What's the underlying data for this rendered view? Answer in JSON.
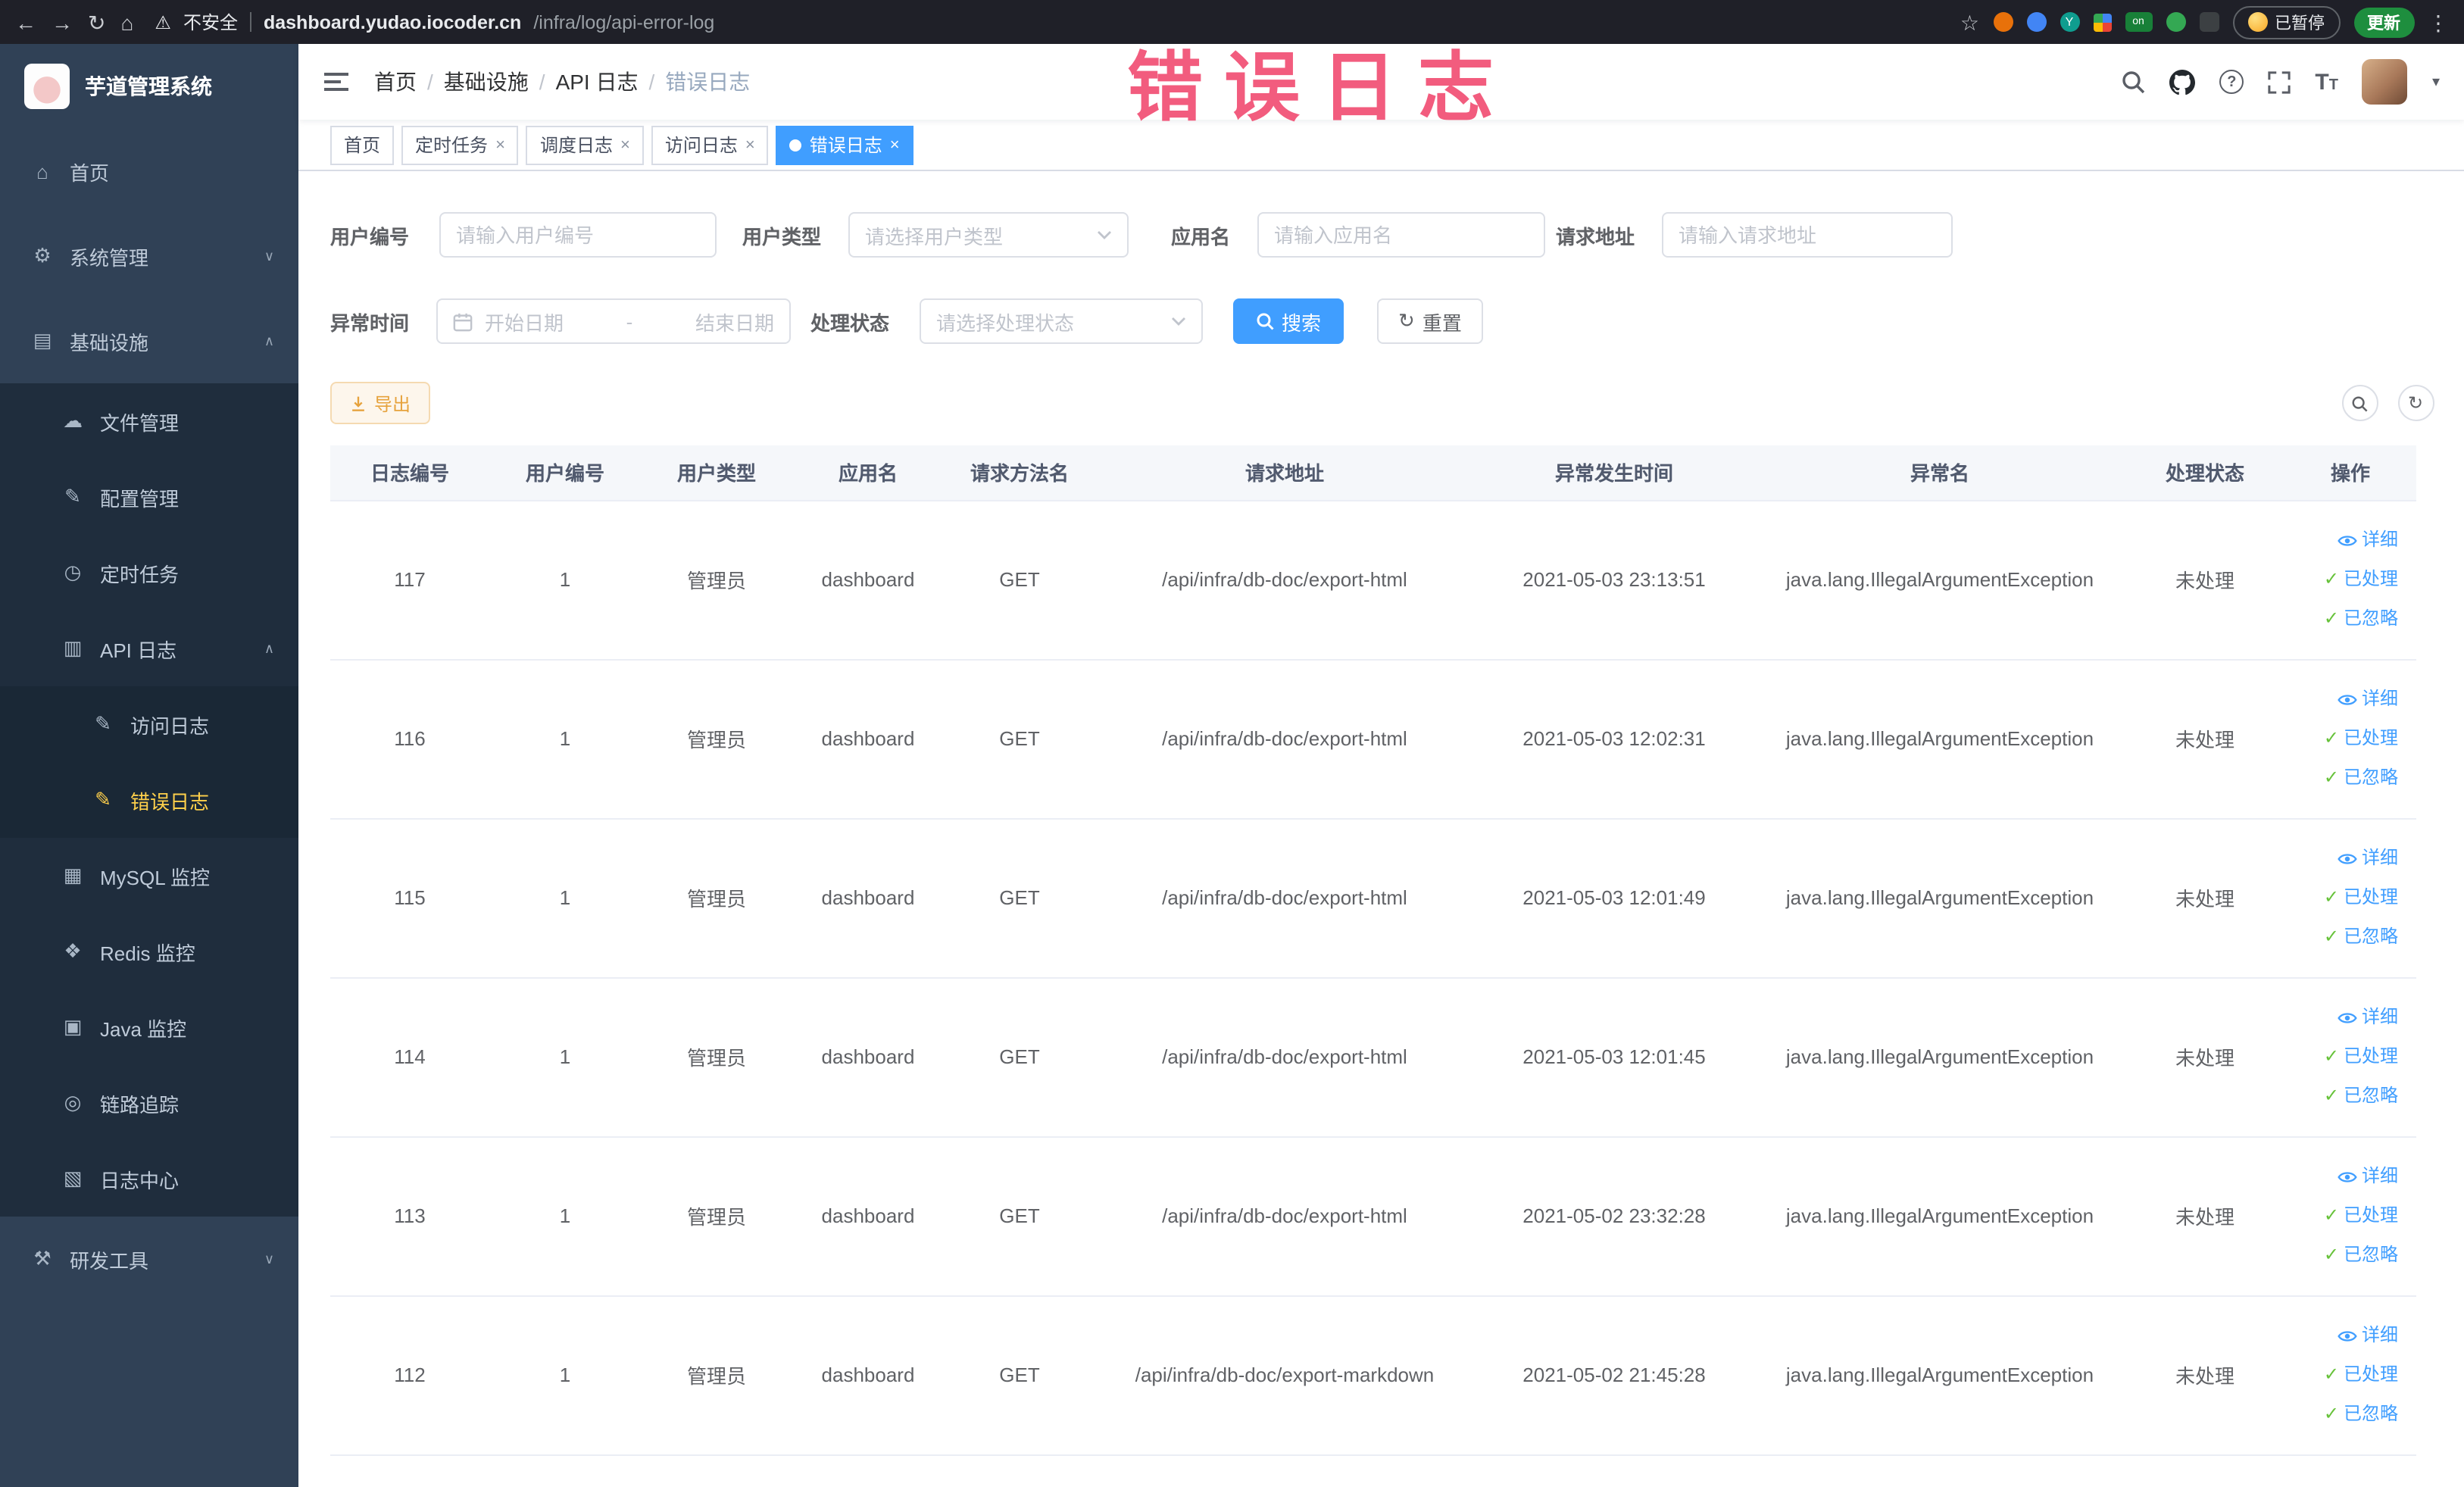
{
  "browser": {
    "security_label": "不安全",
    "url_host": "dashboard.yudao.iocoder.cn",
    "url_path": "/infra/log/api-error-log",
    "paused_label": "已暂停",
    "update_label": "更新",
    "on_badge": "on",
    "ext_teal_letter": "Y"
  },
  "watermark": "错误日志",
  "sidebar": {
    "logo_title": "芋道管理系统",
    "items": [
      {
        "label": "首页",
        "level": 1
      },
      {
        "label": "系统管理",
        "level": 1,
        "arrow": "down"
      },
      {
        "label": "基础设施",
        "level": 1,
        "arrow": "up",
        "expanded": true
      },
      {
        "label": "文件管理",
        "level": 2
      },
      {
        "label": "配置管理",
        "level": 2
      },
      {
        "label": "定时任务",
        "level": 2
      },
      {
        "label": "API 日志",
        "level": 2,
        "arrow": "up",
        "expanded": true
      },
      {
        "label": "访问日志",
        "level": 3
      },
      {
        "label": "错误日志",
        "level": 3,
        "active": true
      },
      {
        "label": "MySQL 监控",
        "level": 2
      },
      {
        "label": "Redis 监控",
        "level": 2
      },
      {
        "label": "Java 监控",
        "level": 2
      },
      {
        "label": "链路追踪",
        "level": 2
      },
      {
        "label": "日志中心",
        "level": 2
      },
      {
        "label": "研发工具",
        "level": 1,
        "arrow": "down"
      }
    ]
  },
  "breadcrumb": {
    "items": [
      "首页",
      "基础设施",
      "API 日志",
      "错误日志"
    ],
    "separator": "/"
  },
  "tabs": [
    {
      "label": "首页",
      "active": false,
      "closable": false
    },
    {
      "label": "定时任务",
      "active": false,
      "closable": true
    },
    {
      "label": "调度日志",
      "active": false,
      "closable": true
    },
    {
      "label": "访问日志",
      "active": false,
      "closable": true
    },
    {
      "label": "错误日志",
      "active": true,
      "closable": true
    }
  ],
  "filters": {
    "user_id": {
      "label": "用户编号",
      "placeholder": "请输入用户编号",
      "value": ""
    },
    "user_type": {
      "label": "用户类型",
      "placeholder": "请选择用户类型"
    },
    "app_name": {
      "label": "应用名",
      "placeholder": "请输入应用名",
      "value": ""
    },
    "request_url": {
      "label": "请求地址",
      "placeholder": "请输入请求地址",
      "value": ""
    },
    "exception_time": {
      "label": "异常时间",
      "start_placeholder": "开始日期",
      "separator": "-",
      "end_placeholder": "结束日期"
    },
    "process_status": {
      "label": "处理状态",
      "placeholder": "请选择处理状态"
    },
    "search_label": "搜索",
    "reset_label": "重置"
  },
  "toolbar": {
    "export_label": "导出"
  },
  "table": {
    "columns": [
      "日志编号",
      "用户编号",
      "用户类型",
      "应用名",
      "请求方法名",
      "请求地址",
      "异常发生时间",
      "异常名",
      "处理状态",
      "操作"
    ],
    "actions": [
      "详细",
      "已处理",
      "已忽略"
    ],
    "rows": [
      {
        "id": "117",
        "user_id": "1",
        "user_type": "管理员",
        "app": "dashboard",
        "method": "GET",
        "url": "/api/infra/db-doc/export-html",
        "time": "2021-05-03 23:13:51",
        "exception": "java.lang.IllegalArgumentException",
        "status": "未处理"
      },
      {
        "id": "116",
        "user_id": "1",
        "user_type": "管理员",
        "app": "dashboard",
        "method": "GET",
        "url": "/api/infra/db-doc/export-html",
        "time": "2021-05-03 12:02:31",
        "exception": "java.lang.IllegalArgumentException",
        "status": "未处理"
      },
      {
        "id": "115",
        "user_id": "1",
        "user_type": "管理员",
        "app": "dashboard",
        "method": "GET",
        "url": "/api/infra/db-doc/export-html",
        "time": "2021-05-03 12:01:49",
        "exception": "java.lang.IllegalArgumentException",
        "status": "未处理"
      },
      {
        "id": "114",
        "user_id": "1",
        "user_type": "管理员",
        "app": "dashboard",
        "method": "GET",
        "url": "/api/infra/db-doc/export-html",
        "time": "2021-05-03 12:01:45",
        "exception": "java.lang.IllegalArgumentException",
        "status": "未处理"
      },
      {
        "id": "113",
        "user_id": "1",
        "user_type": "管理员",
        "app": "dashboard",
        "method": "GET",
        "url": "/api/infra/db-doc/export-html",
        "time": "2021-05-02 23:32:28",
        "exception": "java.lang.IllegalArgumentException",
        "status": "未处理"
      },
      {
        "id": "112",
        "user_id": "1",
        "user_type": "管理员",
        "app": "dashboard",
        "method": "GET",
        "url": "/api/infra/db-doc/export-markdown",
        "time": "2021-05-02 21:45:28",
        "exception": "java.lang.IllegalArgumentException",
        "status": "未处理"
      }
    ]
  },
  "colors": {
    "accent": "#409eff",
    "active_tab_bg": "#409eff",
    "sidebar_bg": "#304156",
    "sidebar_submenu_bg": "#1f2d3d",
    "sidebar_active_text": "#ffd04b",
    "watermark": "#f03f67",
    "export_text": "#e6a23c",
    "success_check": "#67c23a",
    "table_header_bg": "#f5f7fa"
  }
}
